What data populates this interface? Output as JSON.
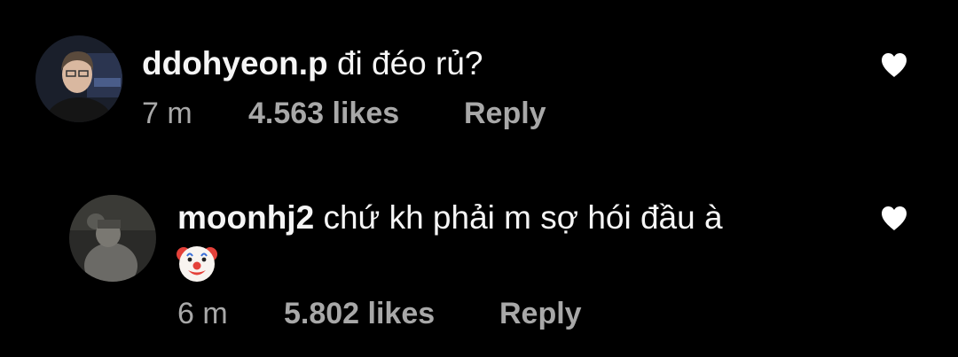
{
  "comments": [
    {
      "username": "ddohyeon.p",
      "text": "đi đéo rủ?",
      "time": "7 m",
      "likes": "4.563 likes",
      "reply_label": "Reply",
      "avatar_icon": "profile-photo",
      "like_icon": "heart-icon"
    },
    {
      "username": "moonhj2",
      "text": "chứ kh phải m sợ hói đầu à",
      "emoji": "clown-face-emoji",
      "time": "6 m",
      "likes": "5.802 likes",
      "reply_label": "Reply",
      "avatar_icon": "profile-photo",
      "like_icon": "heart-icon"
    }
  ],
  "colors": {
    "background": "#000000",
    "primary_text": "#f5f5f5",
    "secondary_text": "#a8a8a8",
    "heart": "#ffffff"
  }
}
